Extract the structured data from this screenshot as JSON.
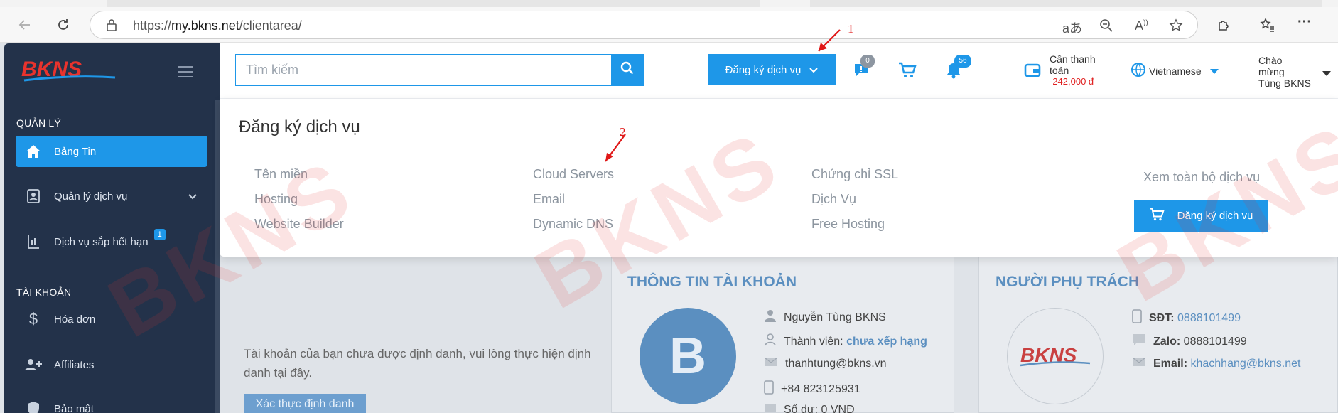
{
  "browser": {
    "url_prefix": "https://",
    "url_domain": "my.bkns.net",
    "url_path": "/clientarea/"
  },
  "sidebar": {
    "logo_text": "BKNS",
    "section_manage": "QUẢN LÝ",
    "items_manage": [
      {
        "label": "Bảng Tin",
        "icon": "home-icon"
      },
      {
        "label": "Quản lý dịch vụ",
        "icon": "id-card-icon"
      },
      {
        "label": "Dịch vụ sắp hết hạn",
        "icon": "bar-chart-icon",
        "badge": "1"
      }
    ],
    "section_account": "TÀI KHOẢN",
    "items_account": [
      {
        "label": "Hóa đơn",
        "icon": "dollar-icon"
      },
      {
        "label": "Affiliates",
        "icon": "user-plus-icon"
      },
      {
        "label": "Bảo mật",
        "icon": "shield-icon"
      }
    ]
  },
  "header": {
    "search_placeholder": "Tìm kiếm",
    "register_button": "Đăng ký dịch vụ",
    "ticket_count": "0",
    "notification_count": "56",
    "payment_label_line1": "Cần thanh",
    "payment_label_line2": "toán",
    "payment_amount": "-242,000 đ",
    "language": "Vietnamese",
    "greeting_line1": "Chào",
    "greeting_line2": "mừng",
    "greeting_line3": "Tùng BKNS"
  },
  "dropdown": {
    "title": "Đăng ký dịch vụ",
    "col1": [
      "Tên miền",
      "Hosting",
      "Website Builder"
    ],
    "col2": [
      "Cloud Servers",
      "Email",
      "Dynamic DNS"
    ],
    "col3": [
      "Chứng chỉ SSL",
      "Dịch Vụ",
      "Free Hosting"
    ],
    "view_all": "Xem toàn bộ dịch vụ",
    "register_button": "Đăng ký dịch vụ"
  },
  "annotations": {
    "a1": "1",
    "a2": "2"
  },
  "content": {
    "verify_text": "Tài khoản của bạn chưa được định danh, vui lòng thực hiện định danh tại đây.",
    "verify_button": "Xác thực định danh",
    "account_info_title": "THÔNG TIN TÀI KHOẢN",
    "avatar_letter": "B",
    "name": "Nguyễn Tùng BKNS",
    "member_label": "Thành viên:",
    "member_rank": "chưa xếp hạng",
    "email": "thanhtung@bkns.vn",
    "phone": "+84 823125931",
    "balance": "Số dư: 0 VNĐ",
    "manager_title": "NGƯỜI PHỤ TRÁCH",
    "manager_logo": "BKNS",
    "sdt_label": "SĐT:",
    "sdt_value": "0888101499",
    "zalo_label": "Zalo:",
    "zalo_value": "0888101499",
    "email_label": "Email:",
    "email_value": "khachhang@bkns.net"
  },
  "watermark": "BKNS",
  "colors": {
    "accent": "#1e97e8",
    "sidebar": "#23324a",
    "danger": "#e02020"
  }
}
